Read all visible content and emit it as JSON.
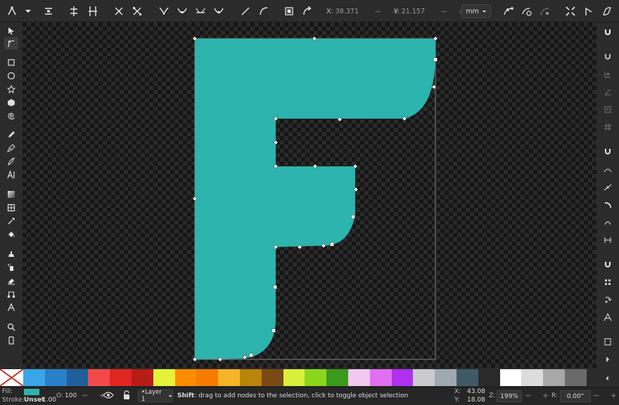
{
  "toolbar": {
    "x_label": "X:",
    "x_value": "38.371",
    "y_label": "Y:",
    "y_value": "21.157",
    "unit": "mm",
    "pm": "− +"
  },
  "colors": {
    "shape_fill": "#2db3ad",
    "node": "#ffffff",
    "bbox": "#9a9a9a"
  },
  "left_tools": [
    "selector-icon",
    "node-tool-icon",
    "rect-icon",
    "ellipse-icon",
    "star-icon",
    "3dbox-icon",
    "spiral-icon",
    "pencil-icon",
    "pen-icon",
    "calligraphy-icon",
    "text-icon",
    "gradient-icon",
    "mesh-icon",
    "dropper-icon",
    "paint-bucket-icon",
    "tweak-icon",
    "spray-icon",
    "eraser-icon",
    "connector-icon",
    "measure-icon",
    "zoom-icon",
    "pages-icon"
  ],
  "palette": [
    "#3aa5e8",
    "#2a7fc8",
    "#1f5f9a",
    "#f24a4a",
    "#e0261f",
    "#b81c16",
    "#e4f23a",
    "#ff8c00",
    "#f57c00",
    "#f5b428",
    "#b8860b",
    "#7a4a12",
    "#d8f03a",
    "#8bd61c",
    "#3a9a1c",
    "#f0c8f0",
    "#e070f0",
    "#b030f0",
    "#c8ccd0",
    "#a0a8b0",
    "#3e5a66",
    "#2a2a2a",
    "#ffffff",
    "#dcdcdc",
    "#a8a8a8",
    "#6a6a6a"
  ],
  "status": {
    "fill_label": "Fill:",
    "stroke_label": "Stroke:",
    "stroke_value": "Unset",
    "stroke_width": "1.00",
    "opacity_label": "O:",
    "opacity_value": "100",
    "layer": "•Layer 1",
    "message_bold": "Shift",
    "message": ": drag to add nodes to the selection, click to toggle object selection",
    "cursor_x_label": "X:",
    "cursor_x": "43.08",
    "cursor_y_label": "Y:",
    "cursor_y": "18.08",
    "zoom_label": "Z:",
    "zoom_value": "199%",
    "rotate_label": "R:",
    "rotate_value": "0.00°"
  }
}
